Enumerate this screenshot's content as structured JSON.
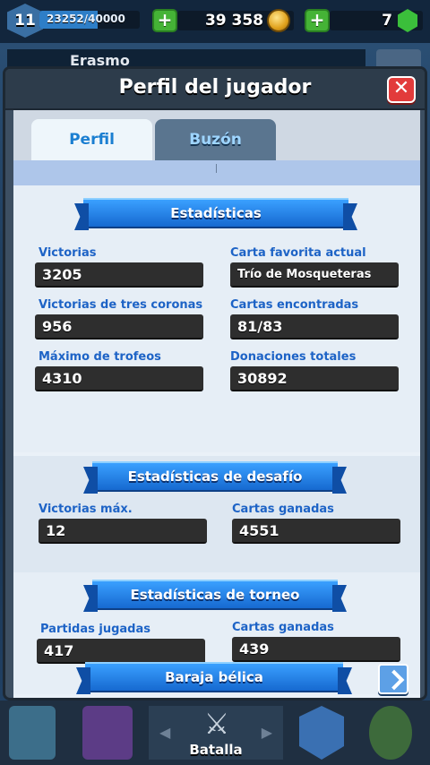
{
  "topbar": {
    "level": "11",
    "xp_text": "23252/40000",
    "xp_progress": 0.581,
    "gold": "39 358",
    "gems": "7"
  },
  "behind": {
    "player_name": "Erasmo"
  },
  "modal": {
    "title": "Perfil del jugador",
    "close_icon": "close-x-icon",
    "tabs": [
      {
        "label": "Perfil",
        "active": true
      },
      {
        "label": "Buzón",
        "active": false
      }
    ]
  },
  "stats": {
    "title": "Estadísticas",
    "items": [
      {
        "label": "Victorias",
        "value": "3205"
      },
      {
        "label": "Carta favorita actual",
        "value": "Trío de Mosqueteras"
      },
      {
        "label": "Victorias de tres coronas",
        "value": "956"
      },
      {
        "label": "Cartas encontradas",
        "value": "81/83"
      },
      {
        "label": "Máximo de trofeos",
        "value": "4310"
      },
      {
        "label": "Donaciones totales",
        "value": "30892"
      }
    ]
  },
  "challenge": {
    "title": "Estadísticas de desafío",
    "items": [
      {
        "label": "Victorias máx.",
        "value": "12"
      },
      {
        "label": "Cartas ganadas",
        "value": "4551"
      }
    ]
  },
  "tournament": {
    "title": "Estadísticas de torneo",
    "items": [
      {
        "label": "Partidas jugadas",
        "value": "417"
      },
      {
        "label": "Cartas ganadas",
        "value": "439"
      }
    ]
  },
  "deck": {
    "title": "Baraja bélica"
  },
  "nav": {
    "battle_label": "Batalla"
  },
  "colors": {
    "accent_blue": "#1d63c6",
    "banner_blue": "#2a88ee",
    "close_red": "#e23b3b",
    "plus_green": "#45b336"
  }
}
